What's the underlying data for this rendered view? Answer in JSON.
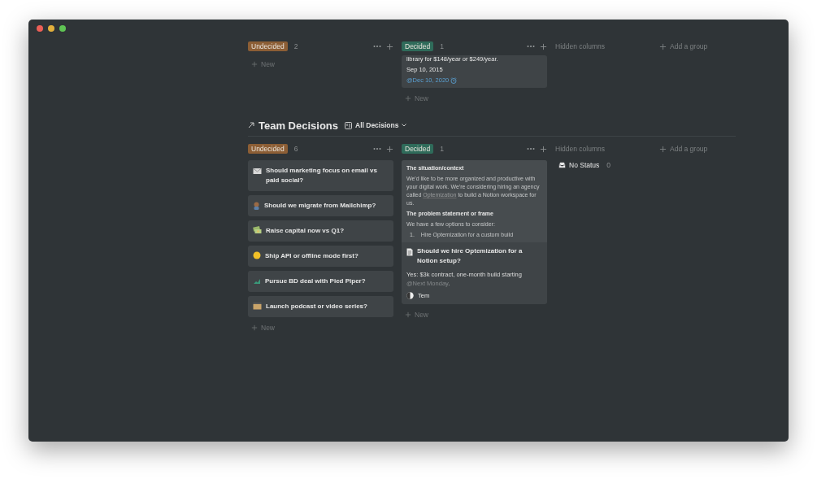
{
  "boards": [
    {
      "groups": [
        {
          "label": "Undecided",
          "color": "#8c5e35",
          "count": "2",
          "new_label": "New"
        },
        {
          "label": "Decided",
          "color": "#2f6b5a",
          "count": "1",
          "cards": [
            {
              "kind": "partial",
              "lines": [
                {
                  "kind": "text",
                  "text": "library for $148/year or $249/year."
                },
                {
                  "kind": "text",
                  "text": "Sep 10, 2015"
                },
                {
                  "kind": "reminder",
                  "text": "@Dec 10, 2020"
                }
              ]
            }
          ],
          "new_label": "New"
        }
      ],
      "hidden": {
        "label": "Hidden columns"
      },
      "add_group": "Add a group"
    },
    {
      "title": "Team Decisions",
      "view": "All Decisions",
      "groups": [
        {
          "label": "Undecided",
          "color": "#8c5e35",
          "count": "6",
          "cards": [
            {
              "kind": "simple",
              "title": "Should marketing focus on email vs paid social?"
            },
            {
              "kind": "simple",
              "title": "Should we migrate from Mailchimp?"
            },
            {
              "kind": "simple",
              "title": "Raise capital now vs Q1?"
            },
            {
              "kind": "simple",
              "title": "Ship API or offline mode first?"
            },
            {
              "kind": "simple",
              "title": "Pursue BD deal with Pied Piper?"
            },
            {
              "kind": "simple",
              "title": "Launch podcast or video series?"
            }
          ],
          "new_label": "New"
        },
        {
          "label": "Decided",
          "color": "#2f6b5a",
          "count": "1",
          "cards": [
            {
              "kind": "full",
              "preview": [
                {
                  "kind": "heading",
                  "text": "The situation/context"
                },
                {
                  "kind": "paragraph",
                  "parts": [
                    {
                      "text": "We'd like to be more organized and productive with your digital work. We're considering hiring an agency called "
                    },
                    {
                      "kind": "link",
                      "text": "Optemization"
                    },
                    {
                      "text": " to build a Notion workspace for us."
                    }
                  ]
                },
                {
                  "kind": "heading",
                  "text": "The problem statement or frame"
                },
                {
                  "kind": "paragraph",
                  "parts": [
                    {
                      "text": "We have a few options to consider:"
                    }
                  ]
                },
                {
                  "kind": "item",
                  "number": "1.",
                  "text": "Hire Optemization for a custom build"
                }
              ],
              "title": "Should we hire Optemization for a Notion setup?",
              "summary": [
                {
                  "text": "Yes: $3k contract, one-month build starting "
                },
                {
                  "kind": "mention",
                  "text": "@Next Monday"
                },
                {
                  "text": "."
                }
              ],
              "person": "Tem"
            }
          ],
          "new_label": "New"
        }
      ],
      "hidden": {
        "label": "Hidden columns",
        "items": [
          {
            "label": "No Status",
            "count": "0"
          }
        ]
      },
      "add_group": "Add a group"
    }
  ]
}
